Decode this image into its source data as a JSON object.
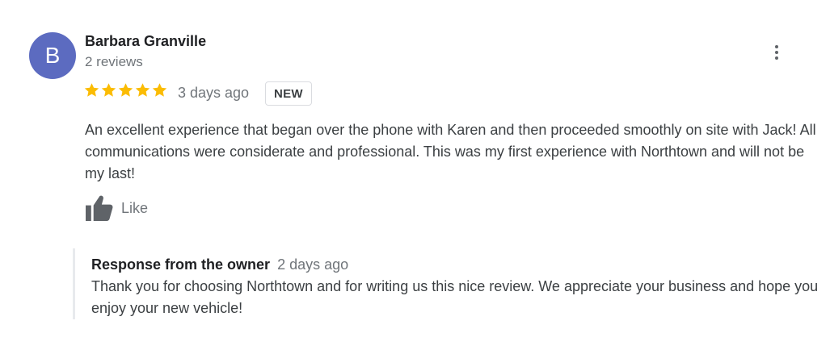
{
  "reviewer": {
    "initial": "B",
    "name": "Barbara Granville",
    "reviews_count": "2 reviews",
    "avatar_color": "#5c6bc0"
  },
  "review": {
    "rating": 5,
    "max_rating": 5,
    "star_color": "#fbbc04",
    "date": "3 days ago",
    "badge": "NEW",
    "text": "An excellent experience that began over the phone with Karen and then proceeded smoothly on site with Jack! All communications were considerate and professional. This was my first experience with Northtown and will not be my last!",
    "like_label": "Like"
  },
  "owner_response": {
    "title": "Response from the owner",
    "date": "2 days ago",
    "text": "Thank you for choosing Northtown and for writing us this nice review. We appreciate your business and hope you enjoy your new vehicle!"
  },
  "icons": {
    "more": "more-vert-icon",
    "star": "star-icon",
    "like": "thumb-up-icon"
  }
}
